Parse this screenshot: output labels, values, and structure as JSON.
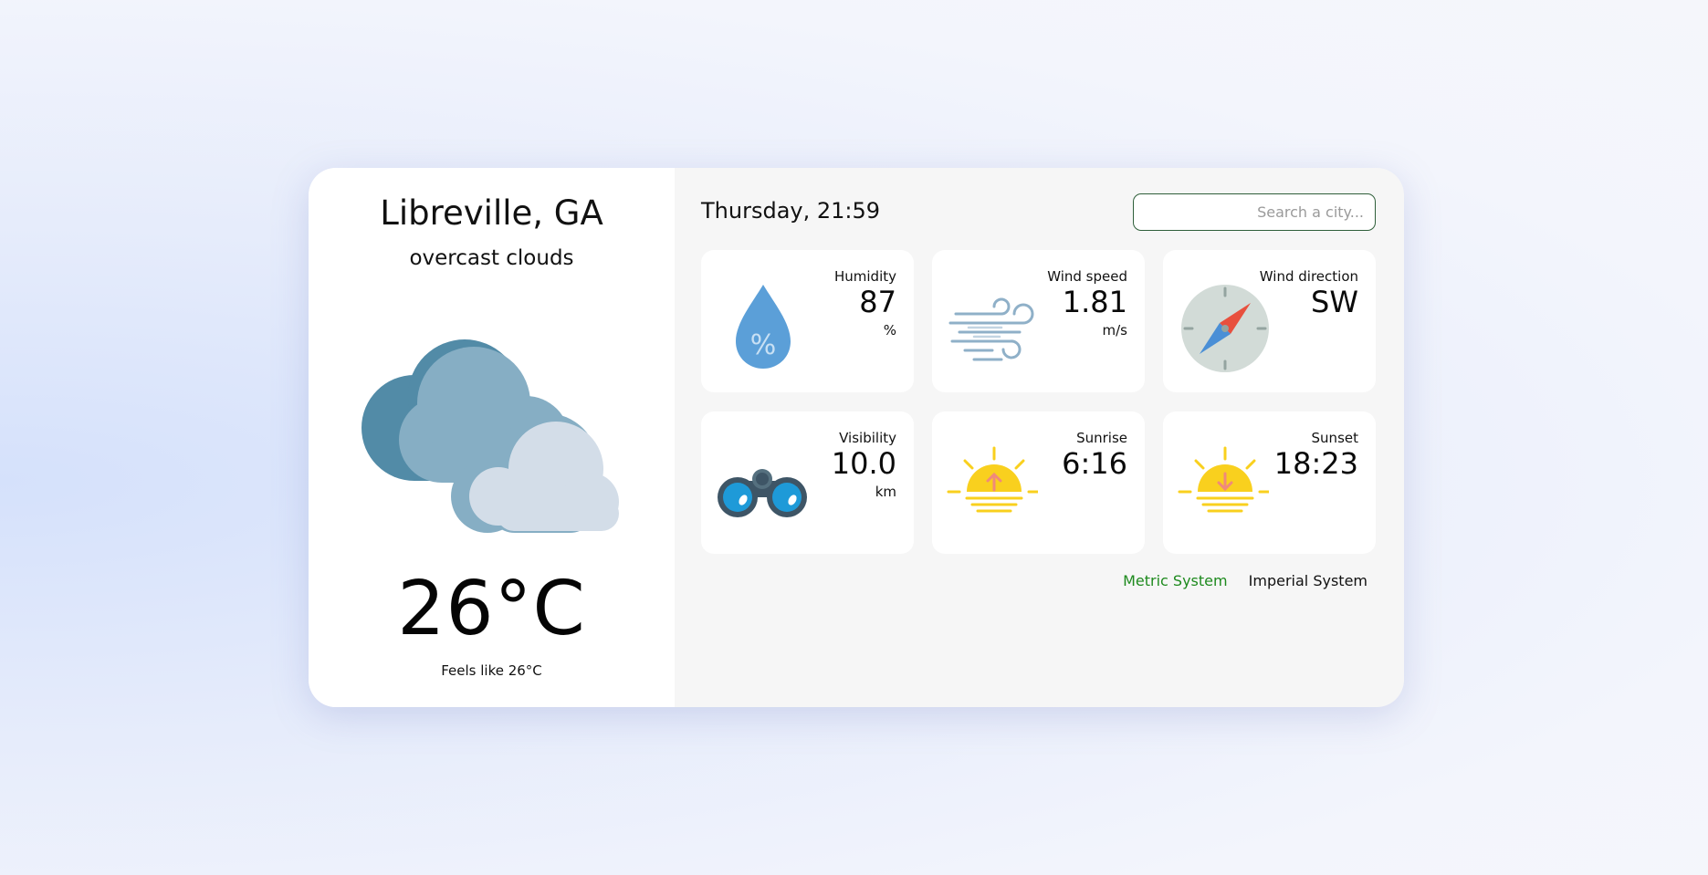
{
  "location": {
    "city": "Libreville, GA",
    "description": "overcast clouds"
  },
  "current": {
    "temp": "26°C",
    "feels_like": "Feels like 26°C"
  },
  "header": {
    "datetime": "Thursday, 21:59"
  },
  "search": {
    "placeholder": "Search a city...",
    "value": ""
  },
  "stats": {
    "humidity": {
      "label": "Humidity",
      "value": "87",
      "unit": "%"
    },
    "wind_speed": {
      "label": "Wind speed",
      "value": "1.81",
      "unit": "m/s"
    },
    "wind_direction": {
      "label": "Wind direction",
      "value": "SW"
    },
    "visibility": {
      "label": "Visibility",
      "value": "10.0",
      "unit": "km"
    },
    "sunrise": {
      "label": "Sunrise",
      "value": "6:16"
    },
    "sunset": {
      "label": "Sunset",
      "value": "18:23"
    }
  },
  "units": {
    "metric": "Metric System",
    "imperial": "Imperial System",
    "active": "metric"
  },
  "icons": {
    "weather": "overcast-clouds-icon",
    "humidity": "water-drop-icon",
    "wind_speed": "wind-icon",
    "wind_direction": "compass-icon",
    "visibility": "binoculars-icon",
    "sunrise": "sunrise-icon",
    "sunset": "sunset-icon"
  },
  "colors": {
    "active_unit": "#1e8a1e",
    "search_border": "#2f5f3a",
    "sun": "#f9d01e",
    "drop": "#5b9fd8"
  }
}
